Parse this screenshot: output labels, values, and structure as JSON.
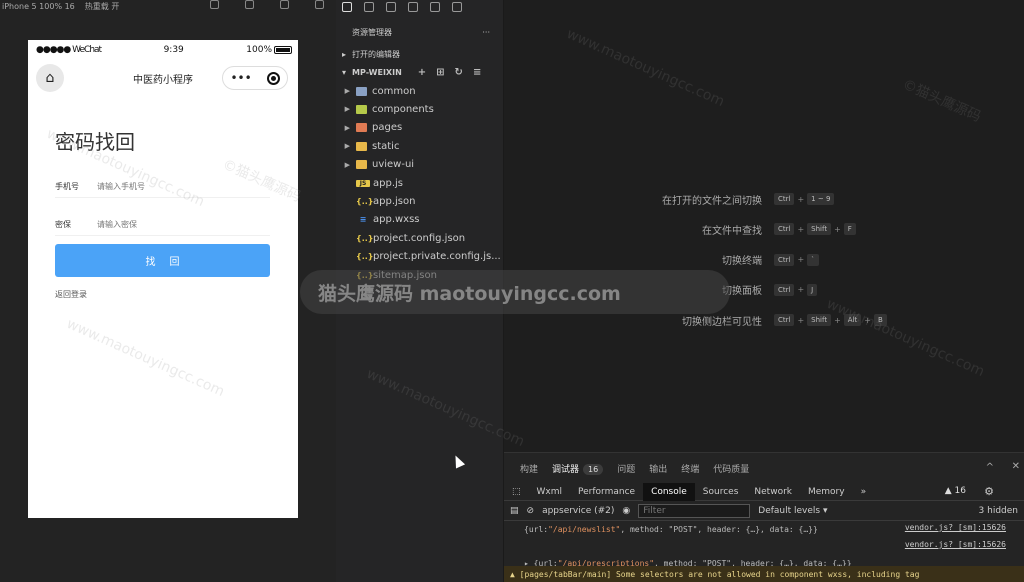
{
  "sim_toolbar": {
    "device": "iPhone 5 100% 16",
    "hot_reload": "热重载 开"
  },
  "phone": {
    "status": {
      "carrier": "●●●●● WeChat",
      "time": "9:39",
      "battery": "100%"
    },
    "nav_title": "中医药小程序",
    "capsule_dots": "•••",
    "page_title": "密码找回",
    "phone_label": "手机号",
    "phone_placeholder": "请输入手机号",
    "pwd_label": "密保",
    "pwd_placeholder": "请输入密保",
    "find_button": "找回",
    "back_login": "返回登录"
  },
  "explorer": {
    "title": "资源管理器",
    "more": "···",
    "open_editors": "打开的编辑器",
    "project": "MP-WEIXIN",
    "items": [
      {
        "label": "common",
        "type": "folder",
        "color": "#8aa1c4"
      },
      {
        "label": "components",
        "type": "folder",
        "color": "#b5c94a"
      },
      {
        "label": "pages",
        "type": "folder",
        "color": "#e07b54"
      },
      {
        "label": "static",
        "type": "folder",
        "color": "#e8b84a"
      },
      {
        "label": "uview-ui",
        "type": "folder",
        "color": "#e8b84a"
      },
      {
        "label": "app.js",
        "type": "js",
        "icon_text": "JS"
      },
      {
        "label": "app.json",
        "type": "json",
        "icon_text": "{..}"
      },
      {
        "label": "app.wxss",
        "type": "wxss",
        "icon_text": "≡"
      },
      {
        "label": "project.config.json",
        "type": "json",
        "icon_text": "{..}"
      },
      {
        "label": "project.private.config.js...",
        "type": "json",
        "icon_text": "{..}"
      },
      {
        "label": "sitemap.json",
        "type": "json",
        "icon_text": "{..}"
      }
    ]
  },
  "shortcuts": [
    {
      "label": "在打开的文件之间切换",
      "keys": [
        "Ctrl",
        "1 ~ 9"
      ]
    },
    {
      "label": "在文件中查找",
      "keys": [
        "Ctrl",
        "Shift",
        "F"
      ]
    },
    {
      "label": "切换终端",
      "keys": [
        "Ctrl",
        "`"
      ]
    },
    {
      "label": "切换面板",
      "keys": [
        "Ctrl",
        "J"
      ]
    },
    {
      "label": "切换侧边栏可见性",
      "keys": [
        "Ctrl",
        "Shift",
        "Alt",
        "B"
      ]
    }
  ],
  "watermark": {
    "banner": "猫头鹰源码 maotouyingcc.com",
    "text": "www.maotouyingcc.com",
    "text_cn": "©猫头鹰源码"
  },
  "devtools": {
    "tabs": [
      {
        "label": "构建",
        "active": false
      },
      {
        "label": "调试器",
        "active": true,
        "badge": "16"
      },
      {
        "label": "问题",
        "active": false
      },
      {
        "label": "输出",
        "active": false
      },
      {
        "label": "终端",
        "active": false
      },
      {
        "label": "代码质量",
        "active": false
      }
    ],
    "cdt_tabs": [
      "Wxml",
      "Performance",
      "Console",
      "Sources",
      "Network",
      "Memory",
      "»"
    ],
    "active_cdt": "Console",
    "warn_count": "▲ 16",
    "context": "appservice (#2)",
    "filter_placeholder": "Filter",
    "levels": "Default levels ▾",
    "hidden": "3 hidden",
    "console_lines": [
      {
        "pre": "{url: ",
        "str": "\"/api/newslist\"",
        "post": ", method: \"POST\", header: {…}, data: {…}}",
        "src": "vendor.js? [sm]:15626"
      },
      {
        "pre": "",
        "str": "",
        "post": "",
        "src": "vendor.js? [sm]:15626"
      },
      {
        "pre": "▸ {url: ",
        "str": "\"/api/prescriptions\"",
        "post": ", method: \"POST\", header: {…}, data: {…}}",
        "src": ""
      }
    ],
    "warning": "▲ [pages/tabBar/main] Some selectors are not allowed in component wxss, including tag"
  }
}
